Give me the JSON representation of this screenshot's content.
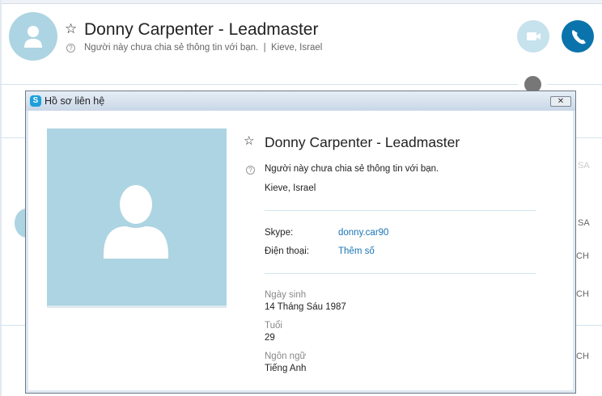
{
  "header": {
    "name": "Donny Carpenter - Leadmaster",
    "status": "Người này chưa chia sẻ thông tin với bạn.",
    "location": "Kieve, Israel"
  },
  "background_times": [
    "SA",
    "SA",
    "CH",
    "CH",
    "CH"
  ],
  "dialog": {
    "title": "Hồ sơ liên hệ",
    "close": "✕",
    "name": "Donny Carpenter - Leadmaster",
    "status": "Người này chưa chia sẻ thông tin với bạn.",
    "location": "Kieve, Israel",
    "skype_label": "Skype:",
    "skype_value": "donny.car90",
    "phone_label": "Điện thoại:",
    "phone_value": "Thêm số",
    "birthday_label": "Ngày sinh",
    "birthday_value": "14 Tháng Sáu 1987",
    "age_label": "Tuổi",
    "age_value": "29",
    "language_label": "Ngôn ngữ",
    "language_value": "Tiếng Anh"
  }
}
